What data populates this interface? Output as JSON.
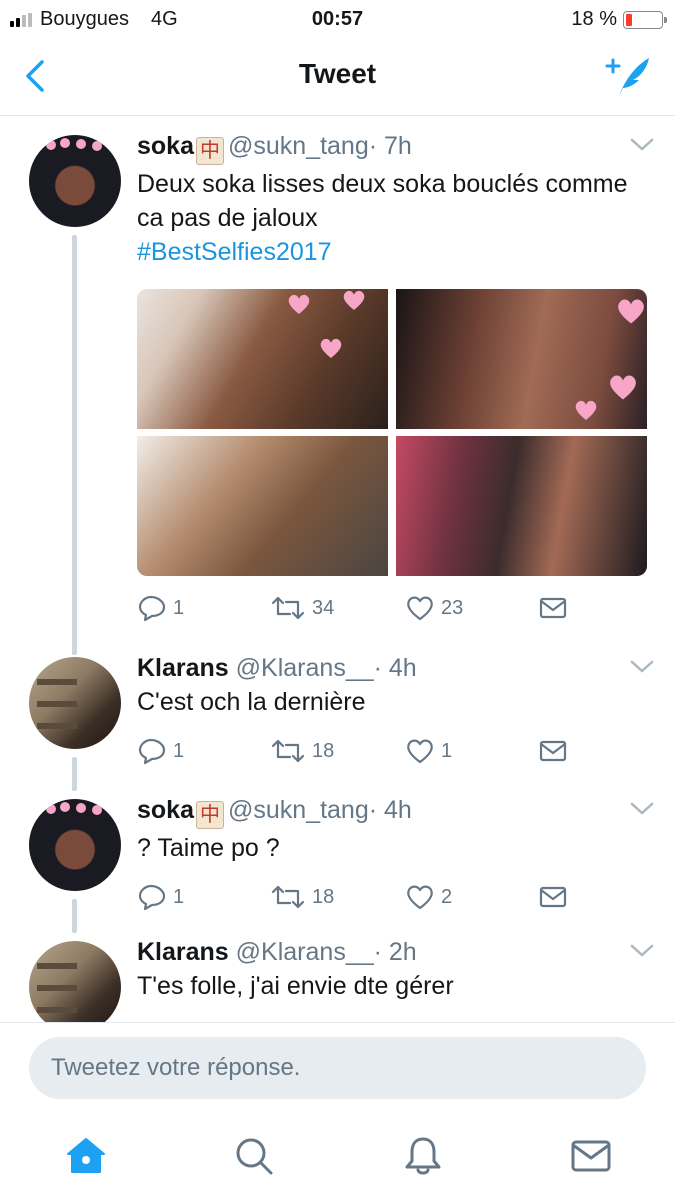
{
  "status_bar": {
    "carrier": "Bouygues",
    "network": "4G",
    "time": "00:57",
    "battery_text": "18 %",
    "battery_level": 0.18,
    "battery_color": "#ff3b30"
  },
  "nav": {
    "title": "Tweet",
    "back_icon": "chevron-left-icon",
    "compose_icon": "compose-tweet-icon",
    "accent": "#1da1f2"
  },
  "tweets": [
    {
      "name": "soka",
      "badge": "🀄",
      "handle": "@sukn_tang",
      "time": "· 7h",
      "text": "Deux soka lisses deux soka bouclés comme ca pas de jaloux",
      "hashtag": "#BestSelfies2017",
      "media_count": 4,
      "replies": "1",
      "retweets": "34",
      "likes": "23"
    },
    {
      "name": "Klarans",
      "handle": "@Klarans__",
      "time": "· 4h",
      "text": "C'est och la dernière",
      "replies": "1",
      "retweets": "18",
      "likes": "1"
    },
    {
      "name": "soka",
      "badge": "🀄",
      "handle": "@sukn_tang",
      "time": "· 4h",
      "text": "? Taime po ?",
      "replies": "1",
      "retweets": "18",
      "likes": "2"
    },
    {
      "name": "Klarans",
      "handle": "@Klarans__",
      "time": "· 2h",
      "text": "T'es folle, j'ai envie dte gérer"
    }
  ],
  "composer": {
    "placeholder": "Tweetez votre réponse."
  },
  "tabbar": {
    "items": [
      "home-icon",
      "search-icon",
      "notifications-icon",
      "messages-icon"
    ],
    "active": "home-icon"
  }
}
